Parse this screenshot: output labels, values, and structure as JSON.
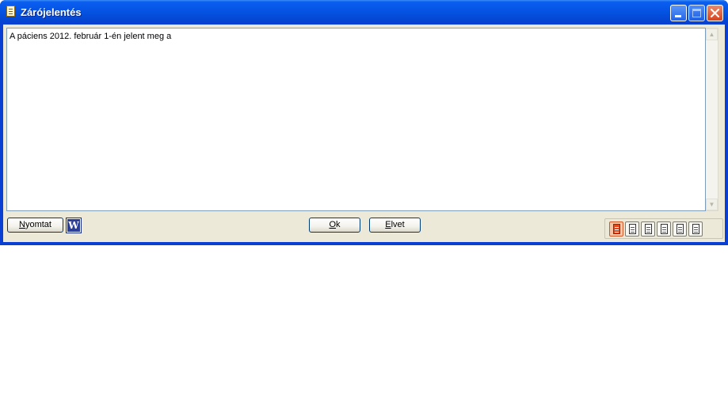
{
  "window": {
    "title": "Zárójelentés"
  },
  "editor": {
    "text": "A páciens 2012. február 1-én jelent meg a"
  },
  "buttons": {
    "print_prefix": "N",
    "print_rest": "yomtat",
    "word_glyph": "W",
    "ok_prefix": "O",
    "ok_rest": "k",
    "cancel_prefix": "E",
    "cancel_rest": "lvet"
  },
  "toolbar": {
    "document_buttons": [
      {
        "icon": "document-icon",
        "active": true
      },
      {
        "icon": "document-icon",
        "active": false
      },
      {
        "icon": "document-icon",
        "active": false
      },
      {
        "icon": "document-icon",
        "active": false
      },
      {
        "icon": "document-icon",
        "active": false
      },
      {
        "icon": "document-icon",
        "active": false
      }
    ]
  },
  "colors": {
    "titlebar": "#0554e4",
    "dialog_background": "#ece9d8",
    "close_button": "#d5441e",
    "active_document": "#e8451a"
  }
}
